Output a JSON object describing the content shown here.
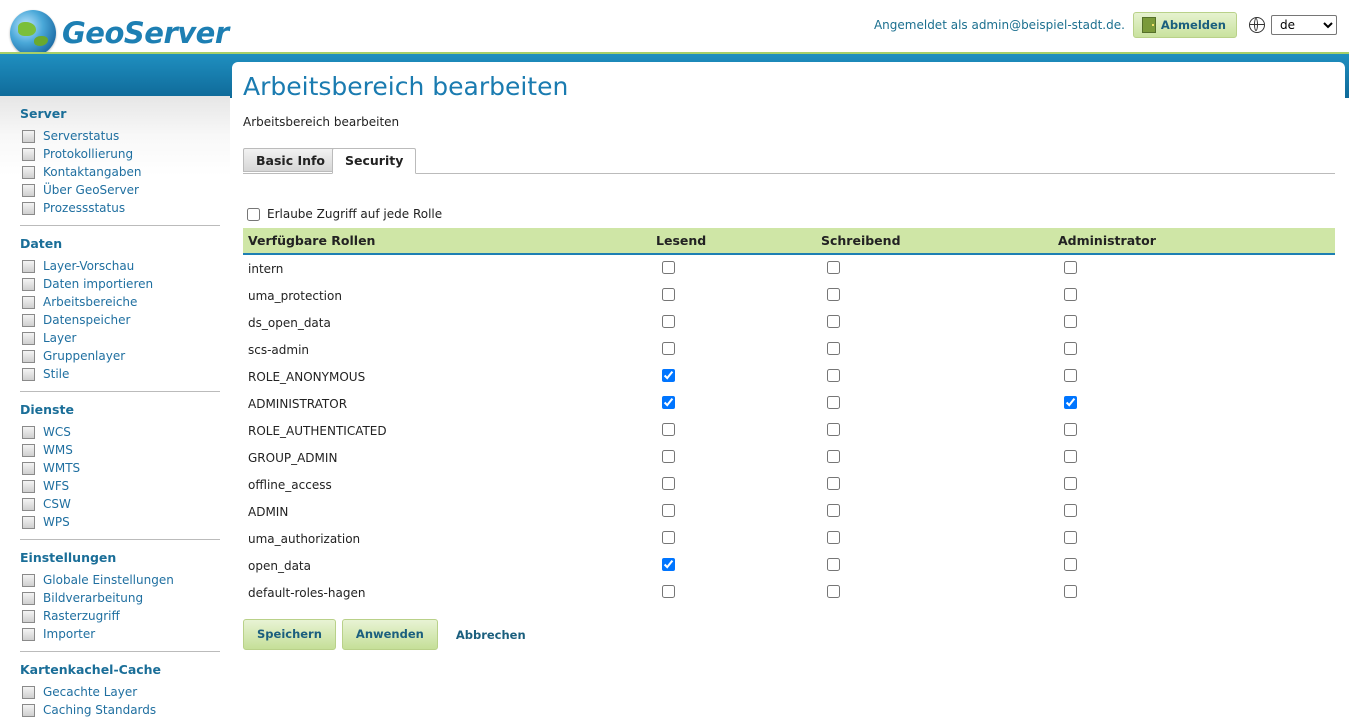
{
  "header": {
    "brand": "GeoServer",
    "logged_in_text": "Angemeldet als admin@beispiel-stadt.de.",
    "logout_label": "Abmelden",
    "language_options": [
      "de"
    ],
    "language_selected": "de"
  },
  "sidebar": {
    "sections": [
      {
        "title": "Server",
        "items": [
          "Serverstatus",
          "Protokollierung",
          "Kontaktangaben",
          "Über GeoServer",
          "Prozessstatus"
        ]
      },
      {
        "title": "Daten",
        "items": [
          "Layer-Vorschau",
          "Daten importieren",
          "Arbeitsbereiche",
          "Datenspeicher",
          "Layer",
          "Gruppenlayer",
          "Stile"
        ]
      },
      {
        "title": "Dienste",
        "items": [
          "WCS",
          "WMS",
          "WMTS",
          "WFS",
          "CSW",
          "WPS"
        ]
      },
      {
        "title": "Einstellungen",
        "items": [
          "Globale Einstellungen",
          "Bildverarbeitung",
          "Rasterzugriff",
          "Importer"
        ]
      },
      {
        "title": "Kartenkachel-Cache",
        "items": [
          "Gecachte Layer",
          "Caching Standards"
        ]
      }
    ]
  },
  "main": {
    "title": "Arbeitsbereich bearbeiten",
    "subtitle": "Arbeitsbereich bearbeiten",
    "tabs": [
      {
        "label": "Basic Info",
        "active": false
      },
      {
        "label": "Security",
        "active": true
      }
    ],
    "any_role_label": "Erlaube Zugriff auf jede Rolle",
    "any_role_checked": false,
    "columns": [
      "Verfügbare Rollen",
      "Lesend",
      "Schreibend",
      "Administrator"
    ],
    "rows": [
      {
        "role": "intern",
        "read": false,
        "write": false,
        "admin": false
      },
      {
        "role": "uma_protection",
        "read": false,
        "write": false,
        "admin": false
      },
      {
        "role": "ds_open_data",
        "read": false,
        "write": false,
        "admin": false
      },
      {
        "role": "scs-admin",
        "read": false,
        "write": false,
        "admin": false
      },
      {
        "role": "ROLE_ANONYMOUS",
        "read": true,
        "write": false,
        "admin": false
      },
      {
        "role": "ADMINISTRATOR",
        "read": true,
        "write": false,
        "admin": true
      },
      {
        "role": "ROLE_AUTHENTICATED",
        "read": false,
        "write": false,
        "admin": false
      },
      {
        "role": "GROUP_ADMIN",
        "read": false,
        "write": false,
        "admin": false
      },
      {
        "role": "offline_access",
        "read": false,
        "write": false,
        "admin": false
      },
      {
        "role": "ADMIN",
        "read": false,
        "write": false,
        "admin": false
      },
      {
        "role": "uma_authorization",
        "read": false,
        "write": false,
        "admin": false
      },
      {
        "role": "open_data",
        "read": true,
        "write": false,
        "admin": false
      },
      {
        "role": "default-roles-hagen",
        "read": false,
        "write": false,
        "admin": false
      }
    ],
    "buttons": {
      "save": "Speichern",
      "apply": "Anwenden",
      "cancel": "Abbrechen"
    }
  },
  "colors": {
    "accent": "#1a7bb0",
    "header_band": "#1f8fc0",
    "table_header": "#cfe6a6",
    "button": "#c5df98"
  }
}
